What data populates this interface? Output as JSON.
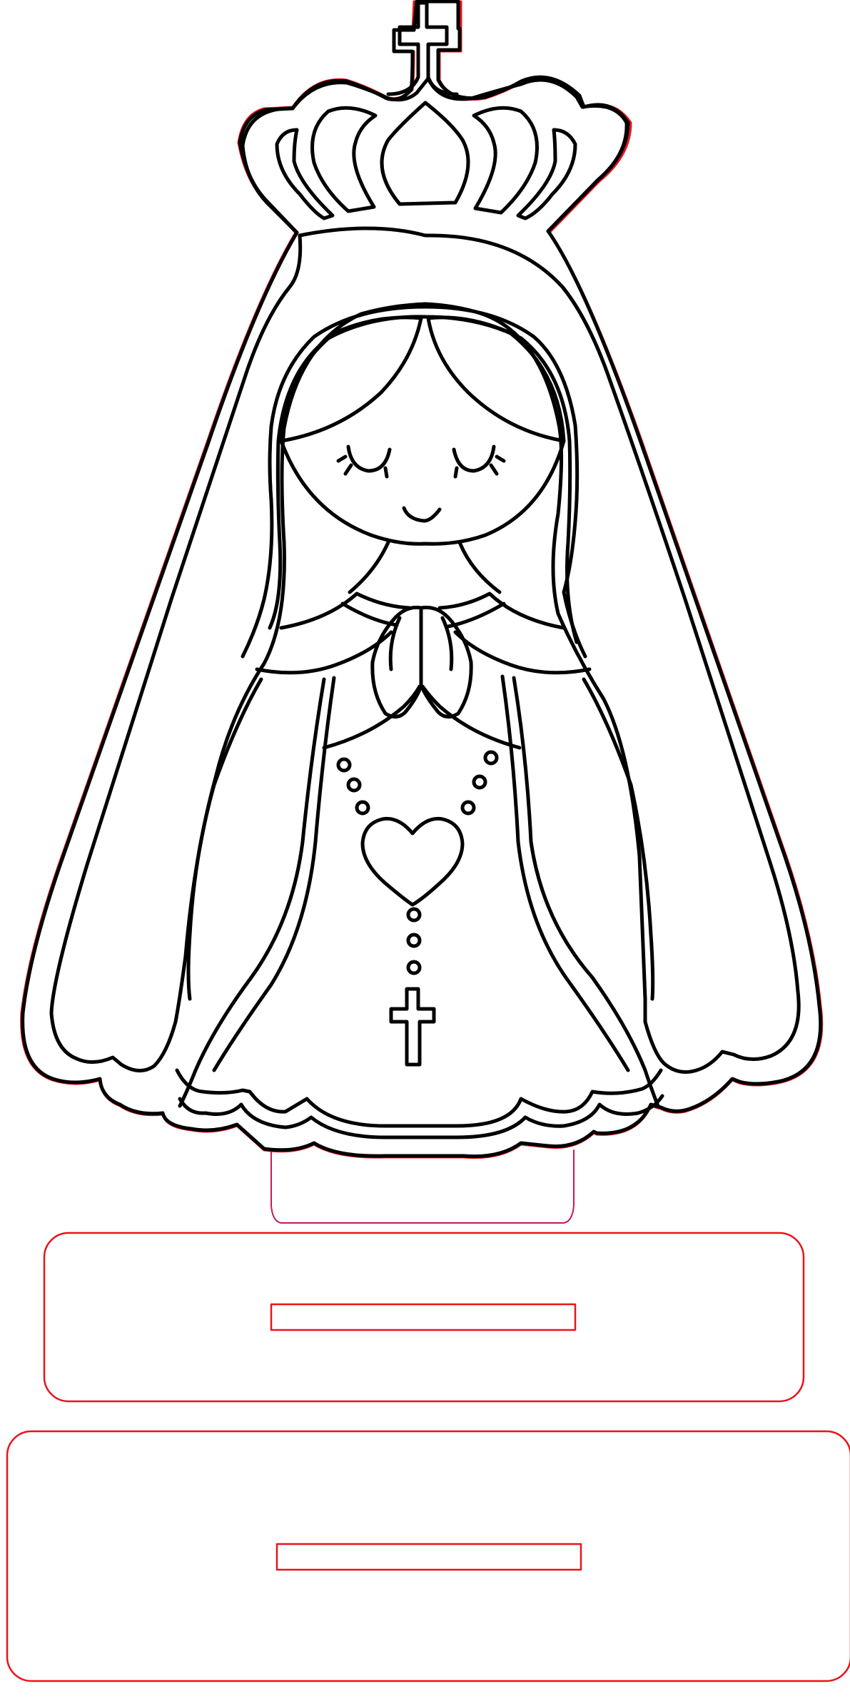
{
  "artwork": {
    "subject": "praying-virgin-with-crown-and-rosary",
    "icons": [
      "crown-icon",
      "cross-icon",
      "heart-icon",
      "rosary-icon",
      "praying-hands-icon"
    ]
  },
  "colors": {
    "line_art": "#000000",
    "cut_line": "#e8141c",
    "engrave_line": "#c8195a",
    "background": "#ffffff"
  },
  "parts": [
    "figure-panel",
    "tab",
    "base-top-plate",
    "base-bottom-plate"
  ]
}
